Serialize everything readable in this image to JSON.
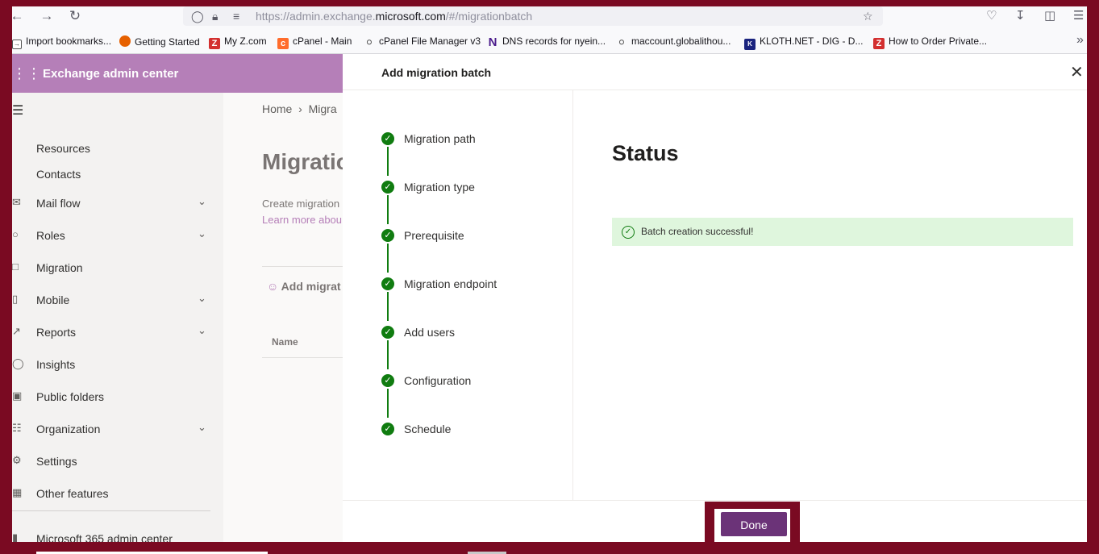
{
  "browser": {
    "url_prefix": "https://admin.exchange.",
    "url_domain": "microsoft.com",
    "url_suffix": "/#/migrationbatch",
    "bookmarks": [
      {
        "label": "Import bookmarks...",
        "icon": "import-icon"
      },
      {
        "label": "Getting Started",
        "icon": "firefox-icon"
      },
      {
        "label": "My Z.com",
        "icon": "z-icon"
      },
      {
        "label": "cPanel - Main",
        "icon": "cpanel-icon"
      },
      {
        "label": "cPanel File Manager v3",
        "icon": "globe-icon"
      },
      {
        "label": "DNS records for nyein...",
        "icon": "n-icon"
      },
      {
        "label": "maccount.globalithou...",
        "icon": "globe-icon"
      },
      {
        "label": "KLOTH.NET - DIG - D...",
        "icon": "kloth-icon"
      },
      {
        "label": "How to Order Private...",
        "icon": "z-icon"
      }
    ]
  },
  "header": {
    "title": "Exchange admin center"
  },
  "nav": {
    "items": [
      {
        "label": "Resources",
        "icon": "",
        "chevron": false
      },
      {
        "label": "Contacts",
        "icon": "",
        "chevron": false
      },
      {
        "label": "Mail flow",
        "icon": "mail-icon",
        "chevron": true
      },
      {
        "label": "Roles",
        "icon": "roles-icon",
        "chevron": true
      },
      {
        "label": "Migration",
        "icon": "migration-icon",
        "chevron": false
      },
      {
        "label": "Mobile",
        "icon": "mobile-icon",
        "chevron": true
      },
      {
        "label": "Reports",
        "icon": "reports-icon",
        "chevron": true
      },
      {
        "label": "Insights",
        "icon": "insights-icon",
        "chevron": false
      },
      {
        "label": "Public folders",
        "icon": "folders-icon",
        "chevron": false
      },
      {
        "label": "Organization",
        "icon": "organization-icon",
        "chevron": true
      },
      {
        "label": "Settings",
        "icon": "settings-icon",
        "chevron": false
      },
      {
        "label": "Other features",
        "icon": "features-icon",
        "chevron": false
      }
    ],
    "footer_link": "Microsoft 365 admin center"
  },
  "background_page": {
    "breadcrumb_home": "Home",
    "breadcrumb_current": "Migra",
    "title": "Migratio",
    "description": "Create migration",
    "learn_more": "Learn more abou",
    "add_button": "Add migrat",
    "column_name": "Name"
  },
  "panel": {
    "title": "Add migration batch",
    "steps": [
      "Migration path",
      "Migration type",
      "Prerequisite",
      "Migration endpoint",
      "Add users",
      "Configuration",
      "Schedule"
    ],
    "status_heading": "Status",
    "success_message": "Batch creation successful!",
    "done_label": "Done"
  },
  "colors": {
    "accent": "#b57fb8",
    "frame": "#7a0a22",
    "success": "#107c10",
    "done_button": "#6b3378"
  }
}
